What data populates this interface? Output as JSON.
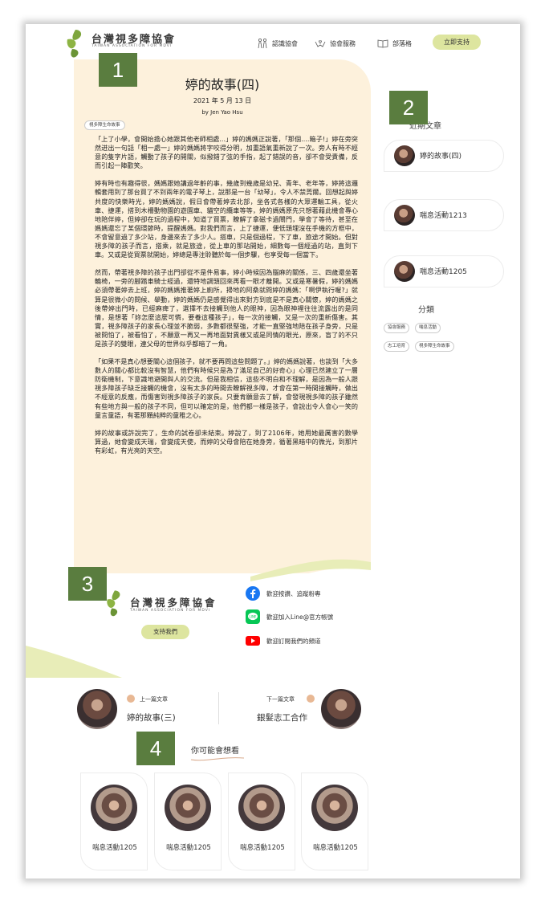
{
  "header": {
    "logo_text": "台灣視多障協會",
    "logo_sub": "TAIWAN ASSOCIATION FOR MDVI",
    "nav": [
      "認識協會",
      "協會服務",
      "部落格"
    ],
    "support_label": "立即支持"
  },
  "article": {
    "title": "婷的故事(四)",
    "date": "2021 年 5 月 13 日",
    "author": "by Jen Yao Hsu",
    "tag": "視多障生命故事",
    "paragraphs": [
      "「上了小學，會開始擔心她跟其他老師相處...」婷的媽媽正說著，「那個....箱子!」婷在旁突然迸出一句話「相一處一」婷的媽媽將字咬得分明，加重語氣重新說了一次。旁人有時不經意的隻字片語，觸動了孩子的開關，似撥錯了弦的手指，起了錯誤的音，卻不會受責備，反而引起一陣歡笑。",
      "婷有時也有趣得很，媽媽跟她講過年齡的事，幾歲到幾歲是幼兒、青年、老年等，婷將這邏輯套用到了那台買了不到兩年的電子琴上，說那是一台「幼琴」，令人不禁莞爾。回想起與婷共度的快樂時光，婷的媽媽說，假日會帶著婷去北部，坐各式各樣的大眾運輸工具，從火車、捷運，搭到木柵動物園的遊園車、貓空的纜車等等，婷的媽媽原先只想著藉此機會專心地陪伴婷，但婷卻在玩的過程中，知道了買票，瞭解了拿磁卡過閘門，學會了等待，甚至在媽媽還忘了某個環節時，提醒媽媽。對我們而言，上了捷運，便低頭埋沒在手機的方框中，不會留意過了多少站，身邊來去了多少人。搭車，只是個過程，下了車，旅途才開始。但對視多障的孩子而言，搭乘，就是旅途，從上車的那站開始，細數每一個經過的站，直到下車。又或是從買票就開始，婷總是專注聆聽於每一個步驟，也享受每一個當下。",
      "然而，帶著視多障的孩子出門卻從不是件易事，婷小時候因為腦麻的關係，三、四歲還坐著輪椅，一旁的腳踏車騎士經過，還特地調頭回來再看一眼才離開。又或是寒暑假，婷的媽媽必須帶著婷去上班，婷的媽媽推著婷上廁所，掃地的阿桑就問婷的媽媽：「啊伊執行喔?」就算是很微小的問候、舉動，婷的媽媽仍是感覺得出來對方到底是不是真心關懷，婷的媽媽之後帶婷出門時，已經麻痺了，選擇不去接觸到他人的眼神，因為眼神裡往往流露出的是同情，是想著「妳怎麼這麼可憐，要養這種孩子」，每一次的接觸，又是一次的重新傷害。其實，視多障孩子的家長心理並不脆弱，多數都很堅強，才能一直堅強地陪在孩子身旁，只是被問怕了，被看怕了，不願意一再又一再地面對異樣又或是同情的眼光，原來，盲了的不只是孩子的雙眼，連父母的世界似乎都暗了一角。",
      "「如果不是真心想要關心這個孩子，就不要再問這些問題了。」婷的媽媽說著，也談到「大多數人的關心都比較沒有智慧，他們有時候只是為了滿足自己的好奇心」心理已然建立了一層防衛機制，下意識地避開與人的交流。但是我相信，這些不明白和不理解，是因為一般人跟視多障孩子缺乏接觸的機會，沒有太多的時間去瞭解視多障，才會在第一時間接觸時，做出不經意的反應，而傷害到視多障孩子的家長。只要肯願意去了解，會發現視多障的孩子雖然有些地方與一般的孩子不同，但可以確定的是，他們都一樣是孩子，會說出令人會心一笑的童言童語，有著那顆純粹的童稚之心。",
      "婷的故事或許說完了，生命的試卷卻未結束。婷說了，到了2106年，她用她最厲害的數學算過，她會變成天瑞，會變成天使，而婷的父母會陪在她身旁，循著黑暗中的微光，到那片有彩虹，有光亮的天空。"
    ]
  },
  "sidebar": {
    "recent_title": "近期文章",
    "recent": [
      "婷的故事(四)",
      "喘息活動1213",
      "喘息活動1205"
    ],
    "category_title": "分類",
    "categories": [
      "協會服務",
      "喘息活動",
      "志工培育",
      "視多障生命故事"
    ]
  },
  "footer": {
    "logo_text": "台灣視多障協會",
    "logo_sub": "TAIWAN ASSOCIATION FOR MDVI",
    "support_label": "支持我們",
    "social": [
      "歡迎按讚、追蹤粉專",
      "歡迎加入Line@官方帳號",
      "歡迎訂閱我們的頻道"
    ]
  },
  "post_nav": {
    "prev_caption": "上一篇文章",
    "prev_title": "婷的故事(三)",
    "next_caption": "下一篇文章",
    "next_title": "銀髮志工合作"
  },
  "related": {
    "title": "你可能會想看",
    "items": [
      "喘息活動1205",
      "喘息活動1205",
      "喘息活動1205",
      "喘息活動1205"
    ]
  },
  "markers": [
    "1",
    "2",
    "3",
    "4"
  ],
  "colors": {
    "accent": "#dde59f",
    "article_bg": "#fdf1dc",
    "footer_bg": "#e8edb8",
    "marker": "#5a7d3f",
    "logo_green": "#7ea63d"
  }
}
